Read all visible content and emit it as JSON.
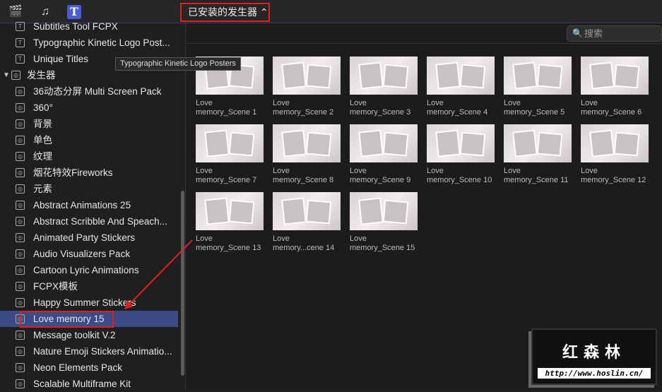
{
  "toolbar": {
    "icons": [
      "clapper-star-icon",
      "music-photo-icon",
      "titles-generators-icon"
    ],
    "dropdown": "已安装的发生器 ⌃"
  },
  "sidebar": {
    "items": [
      {
        "label": "Subtitles Tool FCPX",
        "icon": "title-icon"
      },
      {
        "label": "Typographic Kinetic Logo Post...",
        "icon": "title-icon"
      },
      {
        "label": "Unique Titles",
        "icon": "title-icon"
      },
      {
        "label": "发生器",
        "icon": "generator-icon",
        "group": true
      },
      {
        "label": "36动态分屏 Multi Screen Pack",
        "icon": "generator-icon"
      },
      {
        "label": "360°",
        "icon": "generator-icon"
      },
      {
        "label": "背景",
        "icon": "generator-icon"
      },
      {
        "label": "单色",
        "icon": "generator-icon"
      },
      {
        "label": "纹理",
        "icon": "generator-icon"
      },
      {
        "label": "烟花特效Fireworks",
        "icon": "generator-icon"
      },
      {
        "label": "元素",
        "icon": "generator-icon"
      },
      {
        "label": "Abstract Animations 25",
        "icon": "generator-icon"
      },
      {
        "label": "Abstract Scribble And Speach...",
        "icon": "generator-icon"
      },
      {
        "label": "Animated Party Stickers",
        "icon": "generator-icon"
      },
      {
        "label": "Audio Visualizers Pack",
        "icon": "generator-icon"
      },
      {
        "label": "Cartoon Lyric Animations",
        "icon": "generator-icon"
      },
      {
        "label": "FCPX模板",
        "icon": "generator-icon"
      },
      {
        "label": "Happy Summer Stickers",
        "icon": "generator-icon"
      },
      {
        "label": "Love memory 15",
        "icon": "generator-icon",
        "selected": true
      },
      {
        "label": "Message toolkit V.2",
        "icon": "generator-icon"
      },
      {
        "label": "Nature Emoji Stickers Animatio...",
        "icon": "generator-icon"
      },
      {
        "label": "Neon Elements Pack",
        "icon": "generator-icon"
      },
      {
        "label": "Scalable Multiframe Kit",
        "icon": "generator-icon"
      }
    ]
  },
  "tooltip": "Typographic Kinetic Logo Posters",
  "search": {
    "placeholder": "搜索"
  },
  "clips": [
    {
      "l1": "Love",
      "l2": "memory_Scene 1"
    },
    {
      "l1": "Love",
      "l2": "memory_Scene 2"
    },
    {
      "l1": "Love",
      "l2": "memory_Scene 3"
    },
    {
      "l1": "Love",
      "l2": "memory_Scene 4"
    },
    {
      "l1": "Love",
      "l2": "memory_Scene 5"
    },
    {
      "l1": "Love",
      "l2": "memory_Scene 6"
    },
    {
      "l1": "Love",
      "l2": "memory_Scene 7"
    },
    {
      "l1": "Love",
      "l2": "memory_Scene 8"
    },
    {
      "l1": "Love",
      "l2": "memory_Scene 9"
    },
    {
      "l1": "Love",
      "l2": "memory_Scene 10"
    },
    {
      "l1": "Love",
      "l2": "memory_Scene 11"
    },
    {
      "l1": "Love",
      "l2": "memory_Scene 12"
    },
    {
      "l1": "Love",
      "l2": "memory_Scene 13"
    },
    {
      "l1": "Love",
      "l2": "memory...cene 14"
    },
    {
      "l1": "Love",
      "l2": "memory_Scene 15"
    }
  ],
  "watermark": {
    "title": "红森林",
    "url": "http://www.hoslin.cn/"
  },
  "colors": {
    "selection": "#3c4a86",
    "annotation": "#e02020"
  }
}
